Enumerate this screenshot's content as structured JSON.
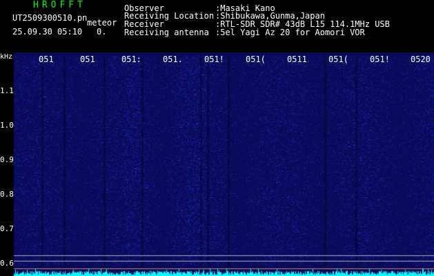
{
  "header": {
    "app_title": "HROFFT",
    "file_name": "UT2509300510.pn",
    "meteor_label": "meteor",
    "datetime": "25.09.30 05:10",
    "count": "0.",
    "info": [
      {
        "key": "Observer",
        "value": ":Masaki Kano"
      },
      {
        "key": "Receiving Location",
        "value": ":Shibukawa,Gunma,Japan"
      },
      {
        "key": "Receiver",
        "value": ":RTL-SDR SDR# 43dB L15 114.1MHz USB"
      },
      {
        "key": "Receiving antenna",
        "value": ":5el Yagi Az 20 for Aomori VOR"
      }
    ]
  },
  "spectrogram": {
    "y_unit": "kHz",
    "x_ticks": [
      "051",
      "051",
      "051:",
      "051.",
      "051!",
      "051(",
      "0511",
      "051(",
      "051!",
      "0520"
    ],
    "y_ticks": [
      "1.1",
      "1.0",
      "0.9",
      "0.8",
      "0.7",
      "0.6"
    ],
    "background_color": "#0a0a5a",
    "noise_color": "#3a4dff",
    "baseline_color": "#00ffff"
  }
}
